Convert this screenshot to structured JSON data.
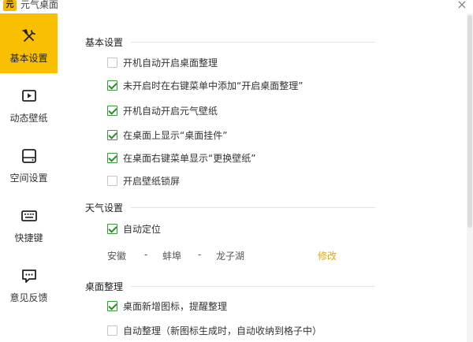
{
  "window": {
    "title": "元气桌面",
    "logo_text": "元",
    "close_glyph": "×"
  },
  "sidebar": {
    "items": [
      {
        "label": "基本设置",
        "active": true
      },
      {
        "label": "动态壁纸",
        "active": false
      },
      {
        "label": "空间设置",
        "active": false
      },
      {
        "label": "快捷键",
        "active": false
      },
      {
        "label": "意见反馈",
        "active": false
      }
    ]
  },
  "sections": {
    "basic": {
      "title": "基本设置",
      "options": [
        {
          "label": "开机自动开启桌面整理",
          "checked": false
        },
        {
          "label": "未开启时在右键菜单中添加“开启桌面整理”",
          "checked": true
        },
        {
          "label": "开机自动开启元气壁纸",
          "checked": true
        },
        {
          "label": "在桌面上显示“桌面挂件”",
          "checked": true
        },
        {
          "label": "在桌面右键菜单显示“更换壁纸”",
          "checked": true
        },
        {
          "label": "开启壁纸锁屏",
          "checked": false
        }
      ]
    },
    "weather": {
      "title": "天气设置",
      "auto_locate": {
        "label": "自动定位",
        "checked": true
      },
      "province": "安徽",
      "city": "蚌埠",
      "district": "龙子湖",
      "separator": "-",
      "modify_label": "修改"
    },
    "desktop": {
      "title": "桌面整理",
      "options": [
        {
          "label": "桌面新增图标，提醒整理",
          "checked": true
        },
        {
          "label": "自动整理（新图标生成时，自动收纳到格子中）",
          "checked": false
        }
      ]
    }
  },
  "colors": {
    "accent": "#f8c000",
    "check": "#2e8b2e",
    "link": "#e8a500"
  }
}
